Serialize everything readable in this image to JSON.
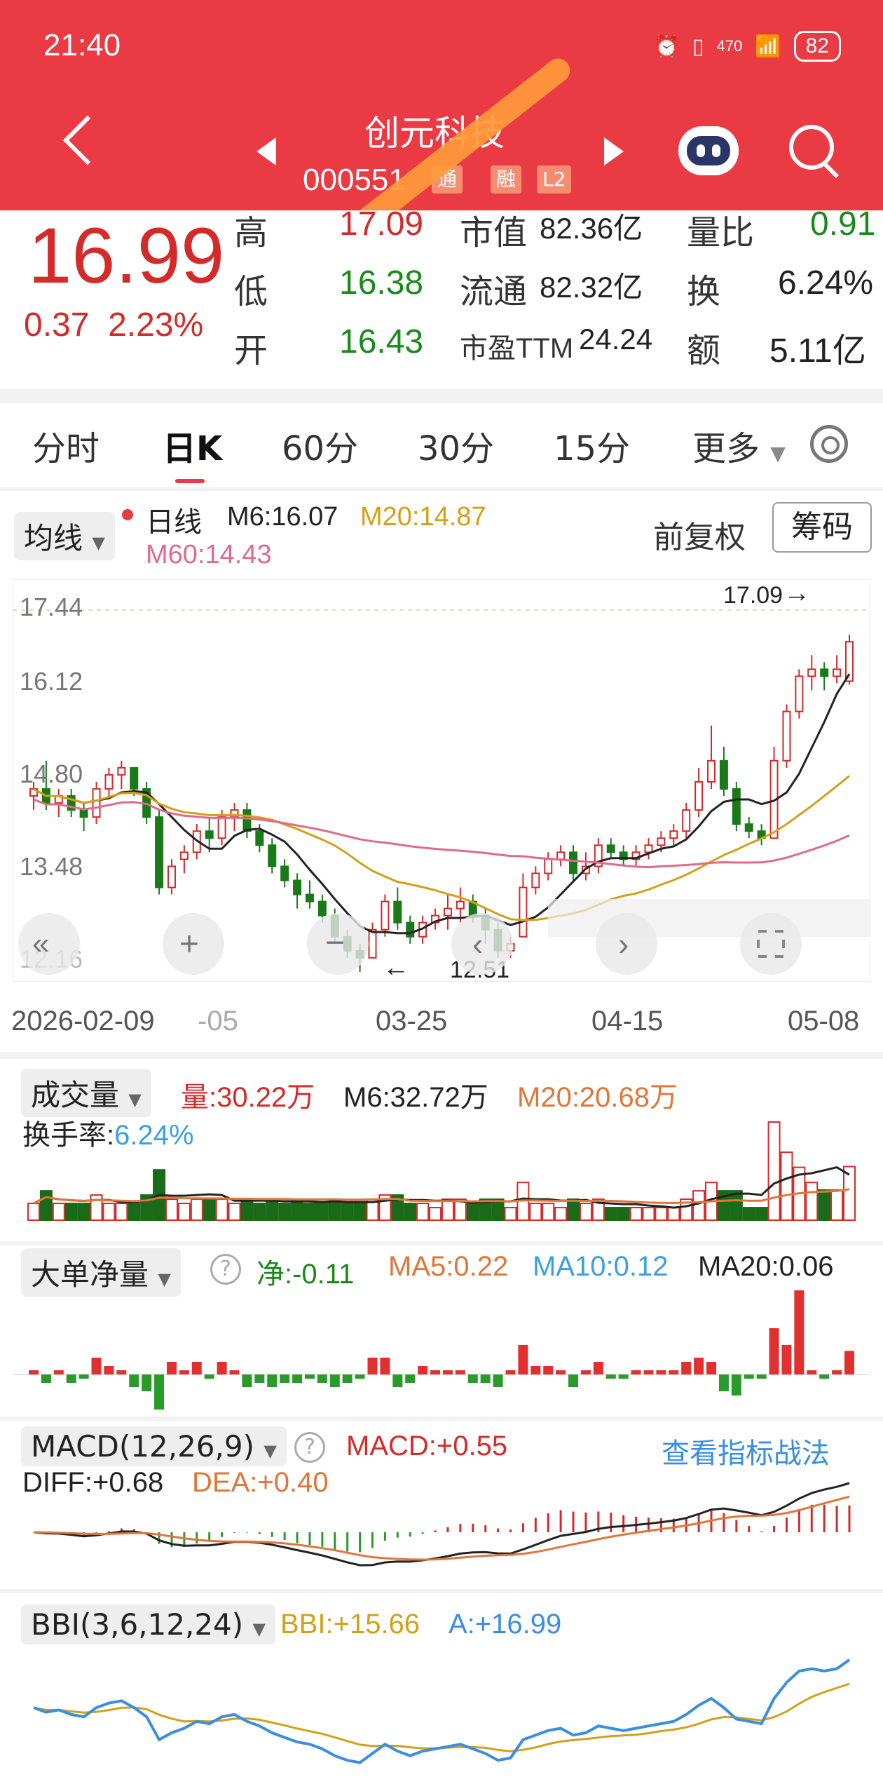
{
  "status_bar": {
    "time": "21:40",
    "net_speed": "470",
    "net_unit": "B/s",
    "battery": "82"
  },
  "stock": {
    "name": "创元科技",
    "code": "000551",
    "tag1": "通",
    "tag2": "融",
    "tag3": "L2"
  },
  "quote": {
    "price": "16.99",
    "change": "0.37",
    "change_pct": "2.23%",
    "high_label": "高",
    "high": "17.09",
    "low_label": "低",
    "low": "16.38",
    "open_label": "开",
    "open": "16.43",
    "mcap_label": "市值",
    "mcap": "82.36亿",
    "float_label": "流通",
    "float": "82.32亿",
    "pe_label": "市盈TTM",
    "pe": "24.24",
    "vr_label": "量比",
    "vr": "0.91",
    "turn_label": "换",
    "turn": "6.24%",
    "amt_label": "额",
    "amt": "5.11亿"
  },
  "tabs": [
    "分时",
    "日K",
    "60分",
    "30分",
    "15分",
    "更多"
  ],
  "kline": {
    "ma_selector": "均线",
    "legend_period": "日线",
    "m6": "M6:16.07",
    "m20": "M20:14.87",
    "m60": "M60:14.43",
    "adjust": "前复权",
    "chip_button": "筹码",
    "y_ticks": [
      "17.44",
      "16.12",
      "14.80",
      "13.48",
      "12.16"
    ],
    "x_ticks": [
      "2026-02-09",
      "-05",
      "03-25",
      "04-15",
      "05-08"
    ],
    "high_mark": "17.09",
    "low_mark": "12.51"
  },
  "volume": {
    "title": "成交量",
    "vol": "量:30.22万",
    "m6": "M6:32.72万",
    "m20": "M20:20.68万",
    "turnover_label": "换手率:",
    "turnover": "6.24%"
  },
  "bigorder": {
    "title": "大单净量",
    "net": "净:-0.11",
    "ma5": "MA5:0.22",
    "ma10": "MA10:0.12",
    "ma20": "MA20:0.06"
  },
  "macd": {
    "title": "MACD(12,26,9)",
    "macd": "MACD:+0.55",
    "diff": "DIFF:+0.68",
    "dea": "DEA:+0.40",
    "link": "查看指标战法"
  },
  "bbi": {
    "title": "BBI(3,6,12,24)",
    "bbi": "BBI:+15.66",
    "a": "A:+16.99"
  },
  "chart_data": {
    "type": "candlestick",
    "y_range": [
      12.16,
      17.44
    ],
    "candles": [
      [
        14.8,
        14.9,
        14.6,
        15.0
      ],
      [
        14.9,
        14.7,
        14.6,
        15.3
      ],
      [
        14.7,
        14.8,
        14.5,
        14.9
      ],
      [
        14.8,
        14.6,
        14.5,
        14.9
      ],
      [
        14.6,
        14.5,
        14.3,
        14.7
      ],
      [
        14.5,
        14.9,
        14.4,
        15.0
      ],
      [
        14.9,
        15.1,
        14.8,
        15.2
      ],
      [
        15.1,
        15.2,
        14.9,
        15.3
      ],
      [
        15.2,
        14.9,
        14.8,
        15.2
      ],
      [
        14.9,
        14.5,
        14.4,
        15.0
      ],
      [
        14.5,
        13.5,
        13.4,
        14.6
      ],
      [
        13.5,
        13.8,
        13.4,
        13.9
      ],
      [
        13.9,
        14.0,
        13.7,
        14.1
      ],
      [
        14.0,
        14.3,
        13.9,
        14.4
      ],
      [
        14.3,
        14.2,
        14.0,
        14.5
      ],
      [
        14.2,
        14.5,
        14.1,
        14.6
      ],
      [
        14.5,
        14.6,
        14.3,
        14.7
      ],
      [
        14.6,
        14.3,
        14.2,
        14.7
      ],
      [
        14.3,
        14.1,
        14.0,
        14.4
      ],
      [
        14.1,
        13.8,
        13.7,
        14.2
      ],
      [
        13.8,
        13.6,
        13.5,
        13.9
      ],
      [
        13.6,
        13.4,
        13.2,
        13.7
      ],
      [
        13.4,
        13.3,
        13.2,
        13.6
      ],
      [
        13.3,
        13.1,
        13.0,
        13.4
      ],
      [
        13.1,
        12.8,
        12.7,
        13.2
      ],
      [
        12.8,
        12.6,
        12.5,
        12.9
      ],
      [
        12.6,
        12.5,
        12.3,
        12.7
      ],
      [
        12.5,
        12.9,
        12.51,
        13.0
      ],
      [
        12.9,
        13.3,
        12.8,
        13.4
      ],
      [
        13.3,
        13.0,
        12.9,
        13.5
      ],
      [
        13.0,
        12.8,
        12.7,
        13.1
      ],
      [
        12.8,
        13.0,
        12.7,
        13.1
      ],
      [
        13.0,
        13.1,
        12.9,
        13.2
      ],
      [
        13.1,
        13.2,
        12.9,
        13.4
      ],
      [
        13.2,
        13.3,
        13.0,
        13.5
      ],
      [
        13.3,
        13.1,
        13.0,
        13.4
      ],
      [
        13.1,
        12.9,
        12.7,
        13.2
      ],
      [
        12.9,
        12.6,
        12.5,
        13.0
      ],
      [
        12.6,
        12.7,
        12.5,
        12.8
      ],
      [
        12.8,
        13.5,
        12.8,
        13.7
      ],
      [
        13.5,
        13.7,
        13.4,
        13.8
      ],
      [
        13.7,
        13.9,
        13.6,
        14.0
      ],
      [
        13.9,
        14.0,
        13.8,
        14.1
      ],
      [
        14.0,
        13.7,
        13.6,
        14.1
      ],
      [
        13.7,
        13.8,
        13.6,
        14.0
      ],
      [
        13.8,
        14.1,
        13.7,
        14.2
      ],
      [
        14.1,
        14.0,
        13.9,
        14.2
      ],
      [
        14.0,
        13.9,
        13.8,
        14.1
      ],
      [
        13.9,
        14.0,
        13.8,
        14.1
      ],
      [
        14.0,
        14.1,
        13.9,
        14.2
      ],
      [
        14.1,
        14.2,
        14.0,
        14.3
      ],
      [
        14.2,
        14.3,
        14.1,
        14.4
      ],
      [
        14.3,
        14.6,
        14.2,
        14.7
      ],
      [
        14.6,
        15.0,
        14.5,
        15.2
      ],
      [
        15.0,
        15.3,
        14.9,
        15.8
      ],
      [
        15.3,
        14.9,
        14.8,
        15.5
      ],
      [
        14.9,
        14.4,
        14.3,
        15.0
      ],
      [
        14.4,
        14.3,
        14.2,
        14.5
      ],
      [
        14.3,
        14.2,
        14.1,
        14.4
      ],
      [
        14.2,
        15.3,
        14.2,
        15.5
      ],
      [
        15.3,
        16.0,
        15.2,
        16.1
      ],
      [
        16.0,
        16.5,
        15.9,
        16.6
      ],
      [
        16.5,
        16.6,
        16.3,
        16.8
      ],
      [
        16.6,
        16.5,
        16.3,
        16.7
      ],
      [
        16.5,
        16.6,
        16.4,
        16.8
      ],
      [
        16.43,
        16.99,
        16.38,
        17.09
      ]
    ]
  }
}
